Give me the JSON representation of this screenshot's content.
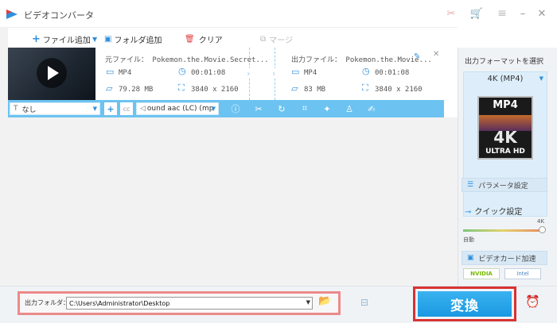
{
  "app": {
    "title": "ビデオコンバータ"
  },
  "toolbar": {
    "add_file": "ファイル追加",
    "add_folder": "フォルダ追加",
    "clear": "クリア",
    "merge": "マージ"
  },
  "file": {
    "source_name": "元ファイル： Pokemon.the.Movie.Secret...",
    "source_format": "MP4",
    "source_duration": "00:01:08",
    "source_size": "79.28 MB",
    "source_resolution": "3840 x 2160",
    "output_name": "出力ファイル： Pokemon.the.Movie...",
    "output_format": "MP4",
    "output_duration": "00:01:08",
    "output_size": "83 MB",
    "output_resolution": "3840 x 2160"
  },
  "settings_bar": {
    "subtitle_value": "なし",
    "audio_value": "ound aac (LC) (mp"
  },
  "right_panel": {
    "select_format_label": "出力フォーマットを選択",
    "format_value": "4K (MP4)",
    "badge_top": "MP4",
    "badge_mid": "4K",
    "badge_bottom": "ULTRA HD",
    "parameter_button": "パラメータ設定",
    "quick_setting_label": "クイック設定",
    "slider_left_label": "自動",
    "slider_right_label": "4K",
    "slider_level_fraction": 1.0,
    "gpu_button": "ビデオカード加速",
    "gpu_nvidia": "NVIDIA",
    "gpu_intel": "Intel"
  },
  "bottom": {
    "output_folder_label": "出力フォルダ：",
    "output_path": "C:\\Users\\Administrator\\Desktop",
    "convert_label": "変換"
  },
  "colors": {
    "accent_blue": "#2f8fdc",
    "bar_blue": "#6cc3f1",
    "highlight_red": "#d83232",
    "highlight_pink": "#ec8a8a"
  }
}
